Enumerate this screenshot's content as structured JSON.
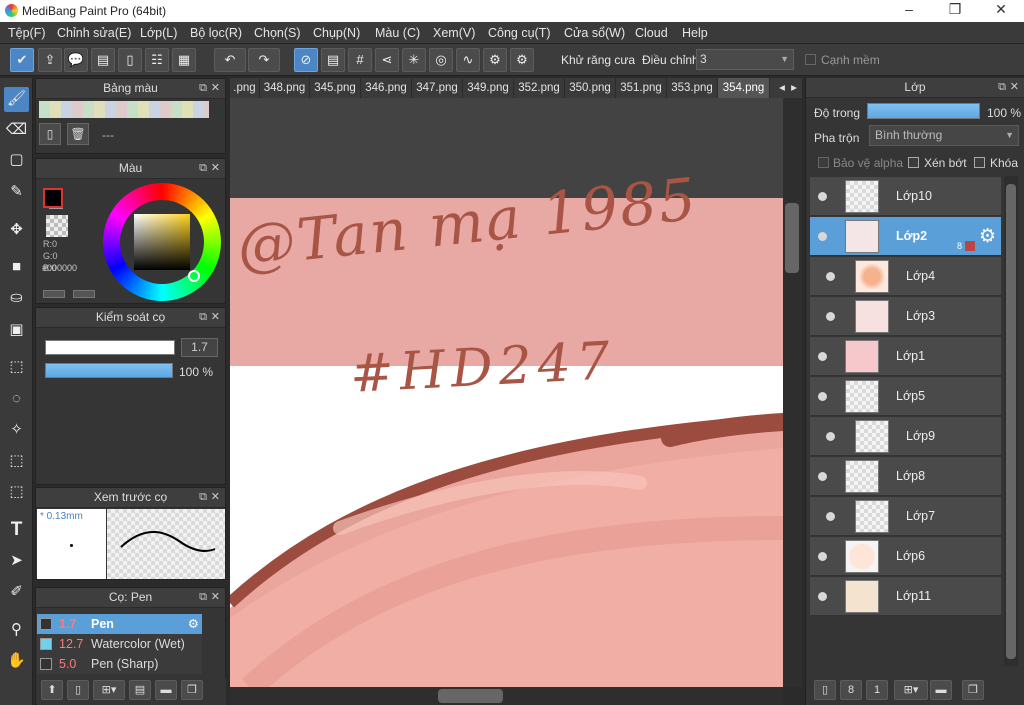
{
  "app": {
    "title": "MediBang Paint Pro (64bit)",
    "min": "–",
    "max": "❒",
    "close": "✕"
  },
  "menu": [
    "Tệp(F)",
    "Chỉnh sửa(E)",
    "Lớp(L)",
    "Bộ lọc(R)",
    "Chọn(S)",
    "Chụp(N)",
    "Màu (C)",
    "Xem(V)",
    "Công cụ(T)",
    "Cửa sổ(W)",
    "Cloud",
    "Help"
  ],
  "toolbar": {
    "antialias_label": "Khử răng cưa",
    "adjust_label": "Điều chỉnh",
    "adjust_value": "3",
    "soft_edge_label": "Cạnh mềm"
  },
  "palette_panel": {
    "title": "Bảng màu",
    "name_value": "---"
  },
  "color_panel": {
    "title": "Màu",
    "r": "R:0",
    "g": "G:0",
    "b": "B:0",
    "hex": "#000000",
    "primary": "#000000"
  },
  "brush_control": {
    "title": "Kiểm soát cọ",
    "size": "1.7",
    "opacity": "100 %"
  },
  "brush_preview": {
    "title": "Xem trước cọ",
    "size_label": "* 0.13mm"
  },
  "brush_panel": {
    "title": "Cọ: Pen",
    "items": [
      {
        "size": "1.7",
        "name": "Pen",
        "color": "#333333"
      },
      {
        "size": "12.7",
        "name": "Watercolor (Wet)",
        "color": "#6fd0f0"
      },
      {
        "size": "5.0",
        "name": "Pen (Sharp)",
        "color": "#333333"
      }
    ]
  },
  "tabs": [
    ".png",
    "348.png",
    "345.png",
    "346.png",
    "347.png",
    "349.png",
    "352.png",
    "350.png",
    "351.png",
    "353.png",
    "354.png"
  ],
  "canvas": {
    "signature_line1": "@Tan mạ 1985",
    "signature_line2": "#HD247"
  },
  "layers_panel": {
    "title": "Lớp",
    "opacity_label": "Độ trong",
    "opacity_value": "100 %",
    "blend_label": "Pha trộn",
    "blend_value": "Bình thường",
    "protect_alpha": "Bảo vệ alpha",
    "clipping": "Xén bớt",
    "lock": "Khóa",
    "layers": [
      {
        "name": "Lớp10",
        "selected": false,
        "indent": false
      },
      {
        "name": "Lớp2",
        "selected": true,
        "indent": false,
        "badge": "8"
      },
      {
        "name": "Lớp4",
        "selected": false,
        "indent": true
      },
      {
        "name": "Lớp3",
        "selected": false,
        "indent": true
      },
      {
        "name": "Lớp1",
        "selected": false,
        "indent": false
      },
      {
        "name": "Lớp5",
        "selected": false,
        "indent": false
      },
      {
        "name": "Lớp9",
        "selected": false,
        "indent": true
      },
      {
        "name": "Lớp8",
        "selected": false,
        "indent": false
      },
      {
        "name": "Lớp7",
        "selected": false,
        "indent": true
      },
      {
        "name": "Lớp6",
        "selected": false,
        "indent": false
      },
      {
        "name": "Lớp11",
        "selected": false,
        "indent": false
      }
    ]
  },
  "colors": {
    "accent": "#4c86c4",
    "selected_layer": "#5a9fd8",
    "canvas_pink": "#e8a9a4",
    "stroke_brown": "#a85545"
  }
}
